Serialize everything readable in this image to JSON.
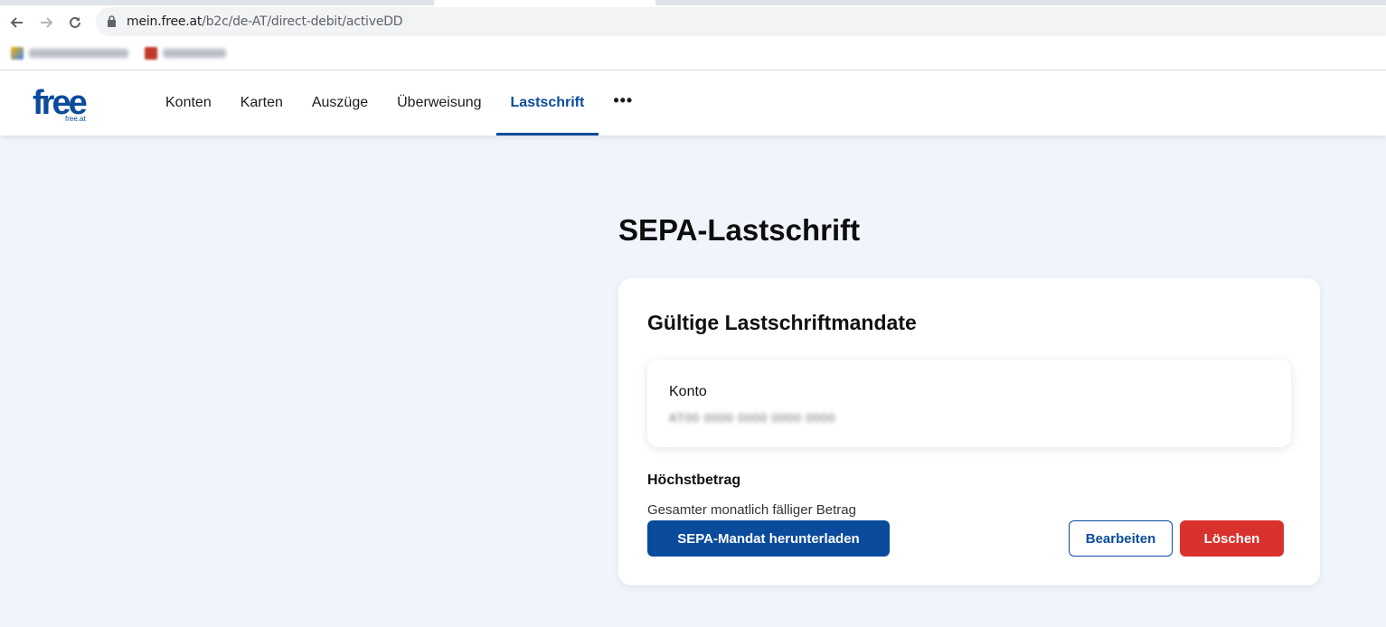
{
  "browser": {
    "url_host": "mein.free.at",
    "url_path": "/b2c/de-AT/direct-debit/activeDD",
    "bookmarks": [
      {
        "icon": "bookmark-favicon-1",
        "label": "redacted"
      },
      {
        "icon": "bookmark-favicon-2",
        "label": "redacted"
      }
    ]
  },
  "header": {
    "logo_text": "free",
    "logo_subtext": "free.at",
    "nav": [
      {
        "label": "Konten",
        "active": false
      },
      {
        "label": "Karten",
        "active": false
      },
      {
        "label": "Auszüge",
        "active": false
      },
      {
        "label": "Überweisung",
        "active": false
      },
      {
        "label": "Lastschrift",
        "active": true
      }
    ],
    "more_label": "•••"
  },
  "main": {
    "title": "SEPA-Lastschrift",
    "card": {
      "title": "Gültige Lastschriftmandate",
      "konto_label": "Konto",
      "konto_value": "AT00 0000 0000 0000 0000",
      "hoechstbetrag_label": "Höchstbetrag",
      "hoechstbetrag_desc": "Gesamter monatlich fälliger Betrag",
      "download_button": "SEPA-Mandat herunterladen",
      "edit_button": "Bearbeiten",
      "delete_button": "Löschen"
    }
  },
  "colors": {
    "brand": "#0a4b9b",
    "danger": "#d9322e",
    "background": "#f1f4fb"
  }
}
